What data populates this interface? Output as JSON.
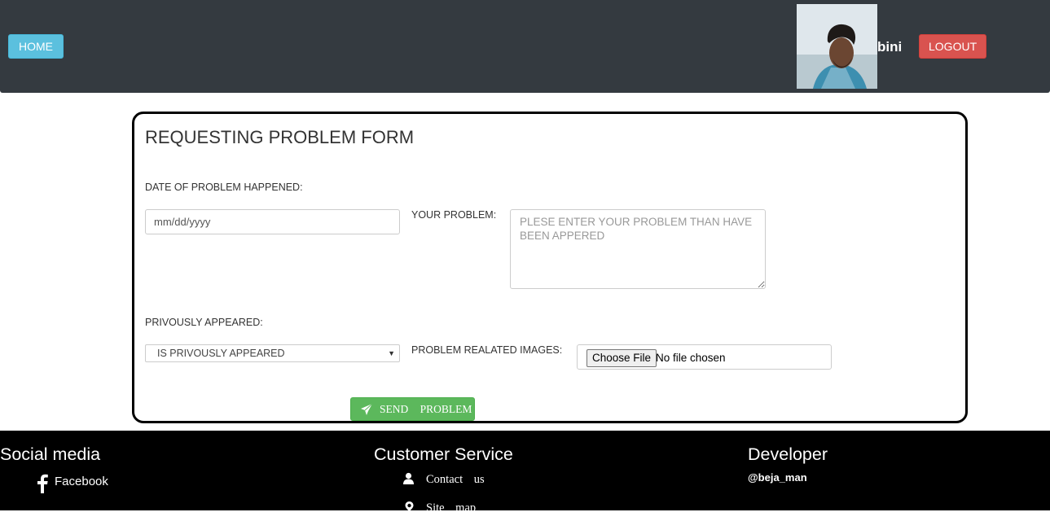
{
  "header": {
    "home_label": "HOME",
    "username": "bini",
    "logout_label": "LOGOUT"
  },
  "form": {
    "title": "REQUESTING PROBLEM FORM",
    "date_label": "DATE OF PROBLEM HAPPENED:",
    "date_placeholder": "mm/dd/yyyy",
    "problem_label": "YOUR PROBLEM:",
    "problem_placeholder": "PLESE ENTER YOUR PROBLEM THAN HAVE BEEN APPERED",
    "appeared_label": "PRIVOUSLY APPEARED:",
    "appeared_selected": "IS PRIVOUSLY APPEARED",
    "images_label": "PROBLEM REALATED IMAGES:",
    "file_button": "Choose File",
    "file_status": "No file chosen",
    "send_label": "SEND PROBLEM"
  },
  "footer": {
    "social_heading": "Social media",
    "social_links": [
      "Facebook"
    ],
    "service_heading": "Customer Service",
    "service_links": [
      "Contact us",
      "Site map"
    ],
    "developer_heading": "Developer",
    "developer_handle": "@beja_man"
  },
  "colors": {
    "header_bg": "#343a40",
    "home_button": "#5bc0de",
    "logout_button": "#d9534f",
    "send_button": "#5cb85c",
    "footer_bg": "#000000"
  },
  "icons": [
    "send-icon",
    "facebook-icon",
    "person-icon",
    "map-marker-icon"
  ]
}
